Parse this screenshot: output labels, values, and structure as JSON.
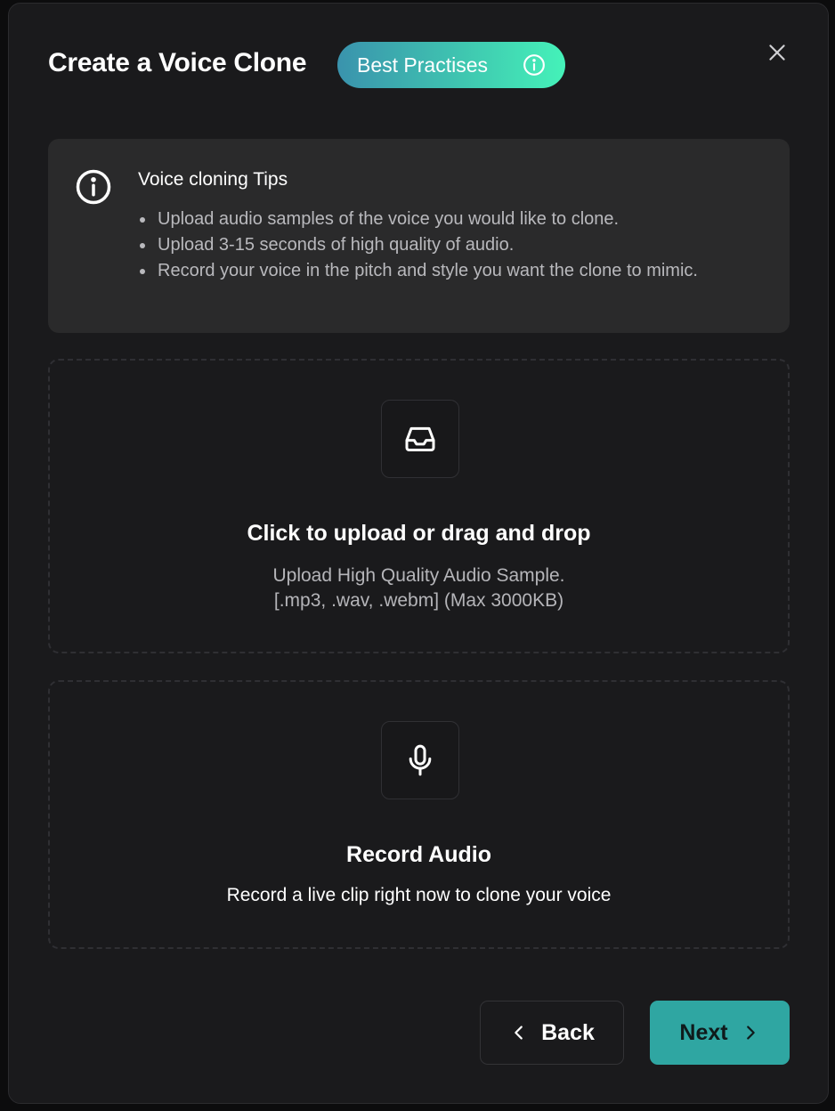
{
  "dialog": {
    "title": "Create a Voice Clone",
    "badge_label": "Best Practises"
  },
  "icons": {
    "close": "close-icon",
    "badge_info": "info-icon",
    "tips_info": "info-circle-icon",
    "upload": "inbox-tray-icon",
    "record": "microphone-icon",
    "back": "chevron-left-icon",
    "next": "chevron-right-icon"
  },
  "tips": {
    "title": "Voice cloning Tips",
    "items": [
      "Upload audio samples of the voice you would like to clone.",
      "Upload 3-15 seconds of high quality of audio.",
      "Record your voice in the pitch and style you want the clone to mimic."
    ]
  },
  "upload": {
    "title": "Click to upload or drag and drop",
    "subtitle_line1": "Upload High Quality Audio Sample.",
    "subtitle_line2": "[.mp3, .wav, .webm] (Max 3000KB)"
  },
  "record": {
    "title": "Record Audio",
    "subtitle": "Record a live clip right now to clone your voice"
  },
  "footer": {
    "back_label": "Back",
    "next_label": "Next"
  },
  "colors": {
    "background": "#1a1a1c",
    "tips_background": "#2a2a2b",
    "badge_gradient_start": "#3a93ad",
    "badge_gradient_end": "#45f2b9",
    "next_button": "#2fa6a2"
  }
}
